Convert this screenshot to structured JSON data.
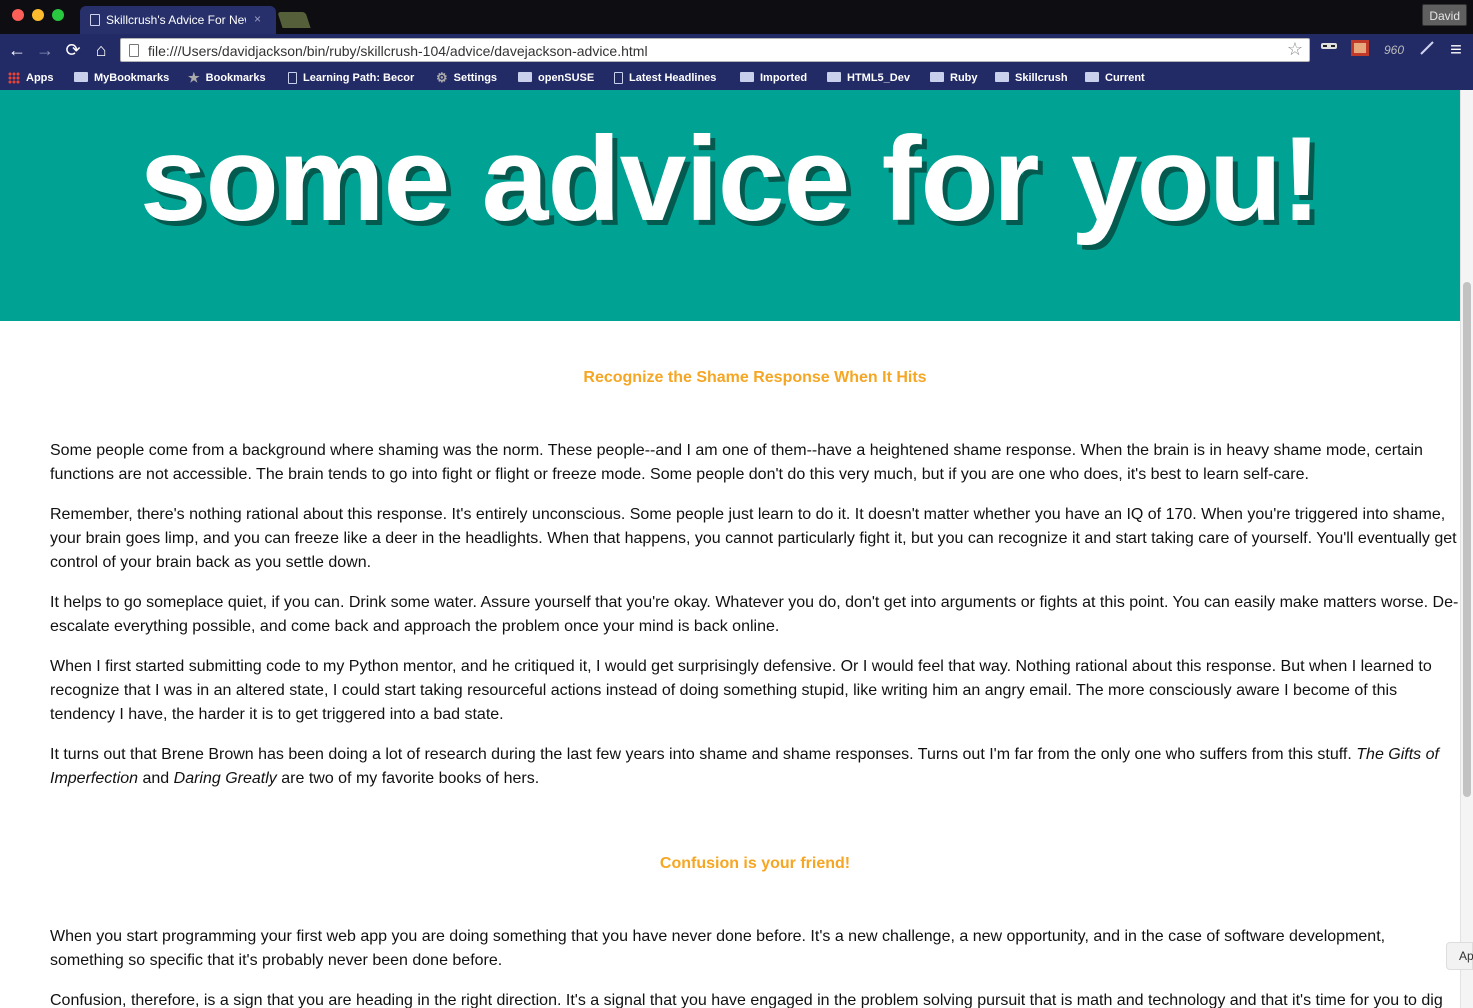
{
  "window": {
    "tab_title": "Skillcrush's Advice For New",
    "tab_close": "×",
    "profile_name": "David"
  },
  "toolbar": {
    "back": "←",
    "forward": "→",
    "reload": "⟳",
    "home": "⌂",
    "url": "file:///Users/davidjackson/bin/ruby/skillcrush-104/advice/davejackson-advice.html",
    "star": "☆",
    "ext_960": "960",
    "menu": "≡"
  },
  "bookmarks": {
    "items": [
      {
        "label": "Apps",
        "icon": "apps-grid-icon"
      },
      {
        "label": "MyBookmarks",
        "icon": "folder-icon"
      },
      {
        "label": "Bookmarks",
        "icon": "star-icon"
      },
      {
        "label": "Learning Path: Becor",
        "icon": "page-icon"
      },
      {
        "label": "Settings",
        "icon": "gear-icon"
      },
      {
        "label": "openSUSE",
        "icon": "folder-icon"
      },
      {
        "label": "Latest Headlines",
        "icon": "page-icon"
      },
      {
        "label": "Imported",
        "icon": "folder-icon"
      },
      {
        "label": "HTML5_Dev",
        "icon": "folder-icon"
      },
      {
        "label": "Ruby",
        "icon": "folder-icon"
      },
      {
        "label": "Skillcrush",
        "icon": "folder-icon"
      },
      {
        "label": "Current",
        "icon": "folder-icon"
      }
    ]
  },
  "page": {
    "hero_title": "some advice for you!",
    "hero_color": "#00a293",
    "accent_color": "#f5a623",
    "sections": [
      {
        "title": "Recognize the Shame Response When It Hits",
        "paragraphs": [
          "Some people come from a background where shaming was the norm. These people--and I am one of them--have a heightened shame response. When the brain is in heavy shame mode, certain functions are not accessible. The brain tends to go into fight or flight or freeze mode. Some people don't do this very much, but if you are one who does, it's best to learn self-care.",
          "Remember, there's nothing rational about this response. It's entirely unconscious. Some people just learn to do it. It doesn't matter whether you have an IQ of 170. When you're triggered into shame, your brain goes limp, and you can freeze like a deer in the headlights. When that happens, you cannot particularly fight it, but you can recognize it and start taking care of yourself. You'll eventually get control of your brain back as you settle down.",
          "It helps to go someplace quiet, if you can. Drink some water. Assure yourself that you're okay. Whatever you do, don't get into arguments or fights at this point. You can easily make matters worse. De-escalate everything possible, and come back and approach the problem once your mind is back online.",
          "When I first started submitting code to my Python mentor, and he critiqued it, I would get surprisingly defensive. Or I would feel that way. Nothing rational about this response. But when I learned to recognize that I was in an altered state, I could start taking resourceful actions instead of doing something stupid, like writing him an angry email. The more consciously aware I become of this tendency I have, the harder it is to get triggered into a bad state."
        ],
        "books_paragraph": {
          "before": "It turns out that Brene Brown has been doing a lot of research during the last few years into shame and shame responses. Turns out I'm far from the only one who suffers from this stuff. ",
          "book1": "The Gifts of Imperfection",
          "between": " and ",
          "book2": "Daring Greatly",
          "after": " are two of my favorite books of hers."
        }
      },
      {
        "title": "Confusion is your friend!",
        "paragraphs": [
          "When you start programming your first web app you are doing something that you have never done before. It's a new challenge, a new opportunity, and in the case of software development, something so specific that it's probably never been done before.",
          "Confusion, therefore, is a sign that you are heading in the right direction. It's a signal that you have engaged in the problem solving pursuit that is math and technology and that it's time for you to dig deeper and keep going because clarity awaits."
        ]
      }
    ],
    "side_chip": "Ap"
  }
}
